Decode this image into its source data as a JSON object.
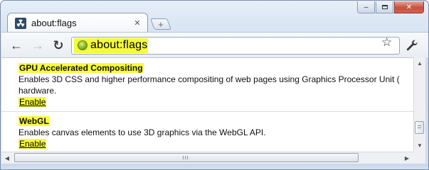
{
  "window": {
    "controls": {
      "minimize": "–",
      "maximize": "",
      "close": "✕"
    }
  },
  "tab": {
    "title": "about:flags",
    "favicon": "radiation-icon",
    "close": "✕"
  },
  "new_tab": {
    "label": "+"
  },
  "toolbar": {
    "back_icon": "←",
    "forward_icon": "→",
    "reload_icon": "↻",
    "star_icon": "☆"
  },
  "omnibox": {
    "url": "about:flags",
    "highlight_color": "#f5fa3a"
  },
  "experiments": [
    {
      "name": "GPU Accelerated Compositing",
      "description": "Enables 3D CSS and higher performance compositing of web pages using Graphics Processor Unit (",
      "description_line2": "hardware.",
      "link": "Enable"
    },
    {
      "name": "WebGL",
      "description": "Enables canvas elements to use 3D graphics via the WebGL API.",
      "link": "Enable"
    }
  ],
  "scrollbars": {
    "up": "▲",
    "down": "▼",
    "left": "◀",
    "right": "▶"
  },
  "colors": {
    "highlight": "#f8fb3c",
    "frame": "#d0def0"
  }
}
